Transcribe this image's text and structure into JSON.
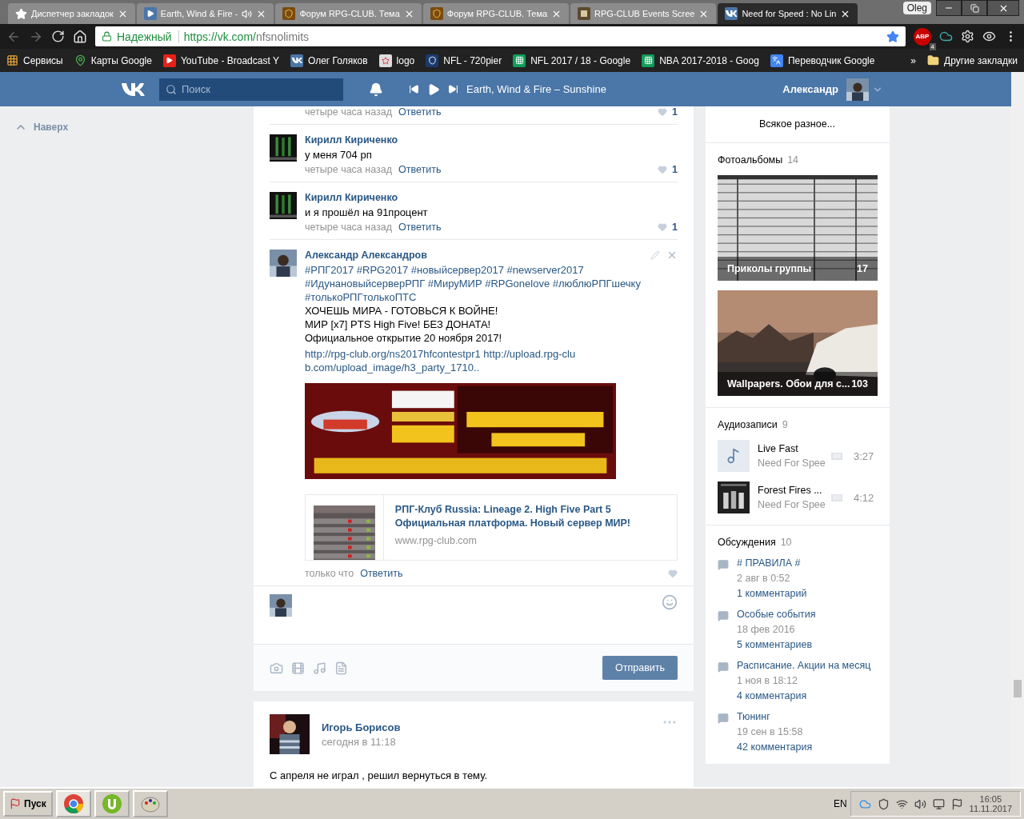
{
  "browser": {
    "tabs": [
      {
        "title": "Диспетчер закладок",
        "kind": "star",
        "audio": false,
        "selected": false
      },
      {
        "title": "Earth, Wind & Fire -",
        "kind": "media",
        "audio": true,
        "selected": false
      },
      {
        "title": "Форум RPG-CLUB. Тема",
        "kind": "emblem",
        "audio": false,
        "selected": false
      },
      {
        "title": "Форум RPG-CLUB. Тема",
        "kind": "emblem",
        "audio": false,
        "selected": false
      },
      {
        "title": "RPG-CLUB Events Scree",
        "kind": "badge",
        "audio": false,
        "selected": false
      },
      {
        "title": "Need for Speed : No Lin",
        "kind": "vk",
        "audio": false,
        "selected": true
      }
    ],
    "profile": "Oleg",
    "address": {
      "secure_label": "Надежный",
      "host": "https://vk.com/",
      "path": "nfsnolimits"
    },
    "adblock_label": "ABP",
    "adblock_count": "4",
    "bookmarks": [
      {
        "label": "Сервисы",
        "kind": "apps"
      },
      {
        "label": "Карты Google",
        "kind": "maps"
      },
      {
        "label": "YouTube - Broadcast Y",
        "kind": "youtube"
      },
      {
        "label": "Олег Голяков",
        "kind": "vk"
      },
      {
        "label": "logo",
        "kind": "logo"
      },
      {
        "label": "NFL - 720pier",
        "kind": "nfl"
      },
      {
        "label": "NFL 2017 / 18 - Google",
        "kind": "sheets"
      },
      {
        "label": "NBA 2017-2018 - Goog",
        "kind": "sheets"
      },
      {
        "label": "Переводчик Google",
        "kind": "translate"
      }
    ],
    "more": "»",
    "other_bookmarks": "Другие закладки"
  },
  "header": {
    "search_placeholder": "Поиск",
    "track": "Earth, Wind & Fire – Sunshine",
    "user": "Александр"
  },
  "left_nav": {
    "back_to_top": "Наверх"
  },
  "comments": [
    {
      "time": "четыре часа назад",
      "reply": "Ответить",
      "likes": "1"
    },
    {
      "name": "Кирилл Кириченко",
      "text": "у меня 704 рп",
      "time": "четыре часа назад",
      "reply": "Ответить",
      "likes": "1"
    },
    {
      "name": "Кирилл Кириченко",
      "text": "и я прошёл на 91процент",
      "time": "четыре часа назад",
      "reply": "Ответить",
      "likes": "1"
    }
  ],
  "own_comment": {
    "name": "Александр Александров",
    "own": true,
    "hashtags": "#РПГ2017 #RPG2017 #новыйсервер2017 #newserver2017 #ИдунановыйсерверРПГ #МируМИР #RPGonelove #люблюРПГшечку #толькоРПГтолькоПТС",
    "lines": [
      "ХОЧЕШЬ МИРА - ГОТОВЬСЯ К ВОЙНЕ!",
      "МИР [x7] PTS High Five! БЕЗ ДОНАТА!",
      "Официальное открытие 20 ноября 2017!"
    ],
    "links": "http://rpg-club.org/ns2017hfcontestpr1 http://upload.rpg-club.com/upload_image/h3_party_1710..",
    "link_card": {
      "title": "РПГ-Клуб Russia: Lineage 2. High Five Part 5 Официальная платформа. Новый сервер МИР!",
      "domain": "www.rpg-club.com"
    },
    "time": "только что",
    "reply": "Ответить"
  },
  "composer": {
    "send": "Отправить"
  },
  "next_post": {
    "author": "Игорь Борисов",
    "time": "сегодня в 11:18",
    "text": "С апреля не играл , решил вернуться в тему."
  },
  "right": {
    "prev_item": "Всякое разное...",
    "albums": {
      "title": "Фотоальбомы",
      "count": "14",
      "items": [
        {
          "title": "Приколы группы",
          "count": "17"
        },
        {
          "title": "Wallpapers. Обои для с...",
          "count": "103"
        }
      ]
    },
    "audio": {
      "title": "Аудиозаписи",
      "count": "9",
      "tracks": [
        {
          "title": "Live Fast",
          "artist": "Need For Spee",
          "duration": "3:27",
          "kind": "placeholder"
        },
        {
          "title": "Forest Fires ...",
          "artist": "Need For Spee",
          "duration": "4:12",
          "kind": "picture"
        }
      ]
    },
    "discussions": {
      "title": "Обсуждения",
      "count": "10",
      "items": [
        {
          "title": "# ПРАВИЛА #",
          "date": "2 авг в 0:52",
          "comments": "1 комментарий"
        },
        {
          "title": "Особые события",
          "date": "18 фев 2016",
          "comments": "5 комментариев"
        },
        {
          "title": "Расписание. Акции на месяц",
          "date": "1 ноя в 18:12",
          "comments": "4 комментария"
        },
        {
          "title": "Тюнинг",
          "date": "19 сен в 15:58",
          "comments": "42 комментария"
        }
      ]
    }
  },
  "taskbar": {
    "start": "Пуск",
    "apps": [
      {
        "kind": "chrome",
        "selected": true
      },
      {
        "kind": "torrent",
        "selected": false
      },
      {
        "kind": "paint",
        "selected": false
      }
    ],
    "language": "EN",
    "time": "16:05",
    "date": "11.11.2017"
  }
}
